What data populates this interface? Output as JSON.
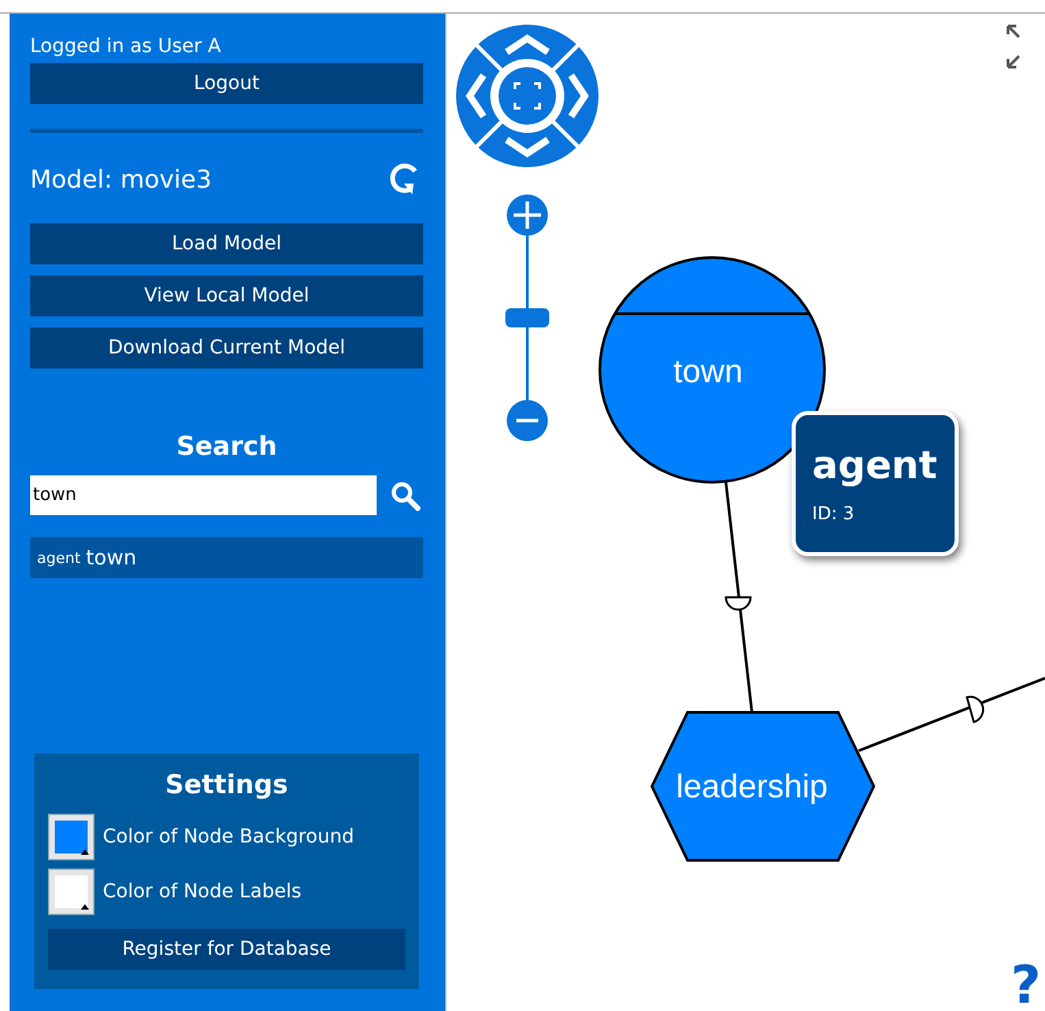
{
  "session": {
    "status": "Logged in as User A",
    "logout_button": "Logout"
  },
  "model": {
    "label": "Model: movie3",
    "buttons": [
      "Load Model",
      "View Local Model",
      "Download Current Model"
    ]
  },
  "search": {
    "heading": "Search",
    "value": "town",
    "results": [
      {
        "type": "agent",
        "name": "town"
      }
    ]
  },
  "settings": {
    "heading": "Settings",
    "colors": [
      {
        "label": "Color of Node Background",
        "color": "#0080ff"
      },
      {
        "label": "Color of Node Labels",
        "color": "#ffffff"
      }
    ],
    "register_button": "Register for Database"
  },
  "graph": {
    "zoom": {
      "level": 0.5
    },
    "nodes": [
      {
        "kind": "circle",
        "label": "town"
      },
      {
        "kind": "hexagon",
        "label": "leadership"
      }
    ],
    "tooltip": {
      "title": "agent",
      "id_text": "ID: 3"
    },
    "help": "?"
  }
}
